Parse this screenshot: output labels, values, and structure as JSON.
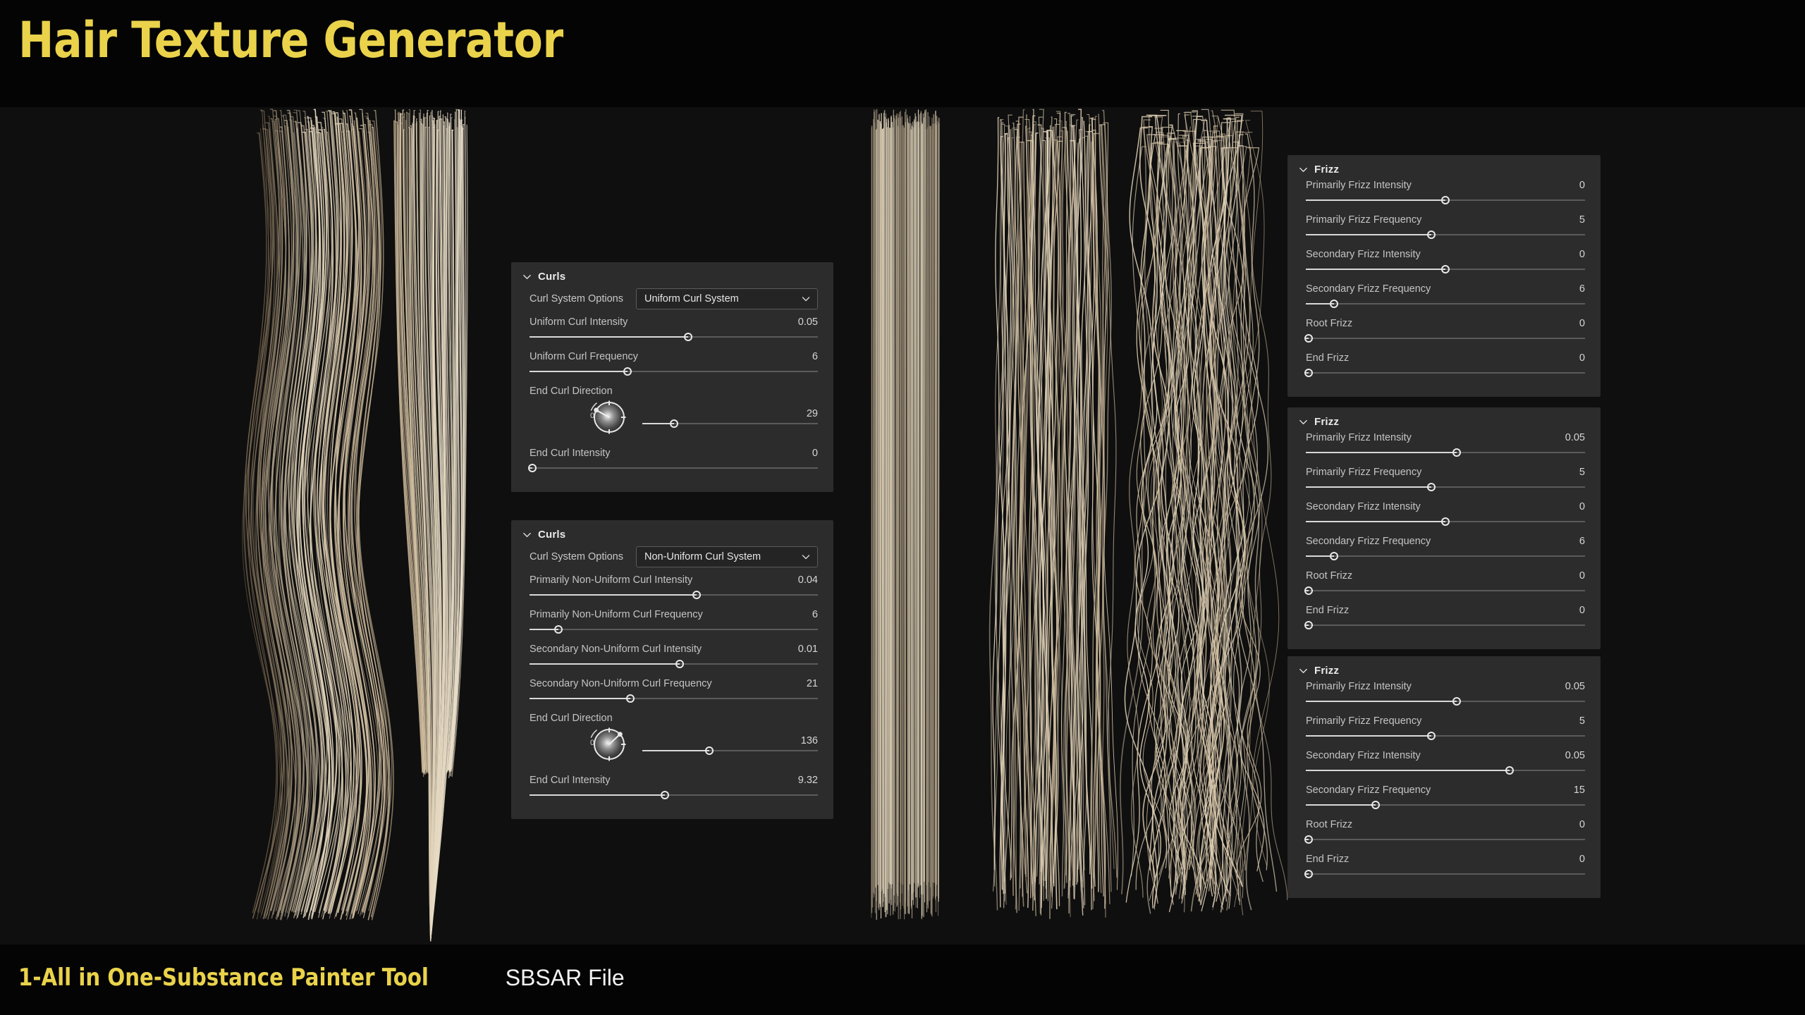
{
  "header": {
    "title": "Hair Texture Generator",
    "accent_color": "#ead34b",
    "band_color": "#040404"
  },
  "footer": {
    "main": "1-All in One-Substance Painter Tool",
    "sub": "SBSAR File"
  },
  "theme": {
    "background": "#0f0f0f",
    "panel_background": "#2c2c2c",
    "slider_fill": "#d9d9d9",
    "slider_track": "#5b5b5b",
    "hair_color": "#c9b596",
    "hair_highlight": "#e3d6bd",
    "hair_shadow": "#6f5f49"
  },
  "renders": [
    {
      "name": "wavy-uniform-curl-preview",
      "style": "wavy"
    },
    {
      "name": "tapered-curl-preview",
      "style": "tapered"
    },
    {
      "name": "straight-no-frizz-preview",
      "style": "straight"
    },
    {
      "name": "light-frizz-preview",
      "style": "light-frizz"
    },
    {
      "name": "heavy-frizz-preview",
      "style": "heavy-frizz"
    }
  ],
  "panels": {
    "curls": [
      {
        "title": "Curls",
        "dropdown": {
          "label": "Curl System Options",
          "value": "Uniform Curl System",
          "options": [
            "Uniform Curl System",
            "Non-Uniform Curl System"
          ]
        },
        "params": [
          {
            "label": "Uniform Curl Intensity",
            "value": "0.05",
            "pct": 55
          },
          {
            "label": "Uniform Curl Frequency",
            "value": "6",
            "pct": 34
          }
        ],
        "dial": {
          "label": "End Curl Direction",
          "value": "29",
          "angle": 299,
          "slider_pct": 18
        },
        "params_after": [
          {
            "label": "End Curl Intensity",
            "value": "0",
            "pct": 1
          }
        ]
      },
      {
        "title": "Curls",
        "dropdown": {
          "label": "Curl System Options",
          "value": "Non-Uniform Curl System",
          "options": [
            "Uniform Curl System",
            "Non-Uniform Curl System"
          ]
        },
        "params": [
          {
            "label": "Primarily Non-Uniform Curl Intensity",
            "value": "0.04",
            "pct": 58
          },
          {
            "label": "Primarily Non-Uniform Curl Frequency",
            "value": "6",
            "pct": 10
          },
          {
            "label": "Secondary Non-Uniform Curl Intensity",
            "value": "0.01",
            "pct": 52
          },
          {
            "label": "Secondary Non-Uniform Curl Frequency",
            "value": "21",
            "pct": 35
          }
        ],
        "dial": {
          "label": "End Curl Direction",
          "value": "136",
          "angle": 47,
          "slider_pct": 38
        },
        "params_after": [
          {
            "label": "End Curl Intensity",
            "value": "9.32",
            "pct": 47
          }
        ]
      }
    ],
    "frizz": [
      {
        "title": "Frizz",
        "params": [
          {
            "label": "Primarily Frizz Intensity",
            "value": "0",
            "pct": 50
          },
          {
            "label": "Primarily Frizz Frequency",
            "value": "5",
            "pct": 45
          },
          {
            "label": "Secondary Frizz Intensity",
            "value": "0",
            "pct": 50
          },
          {
            "label": "Secondary Frizz Frequency",
            "value": "6",
            "pct": 10
          },
          {
            "label": "Root Frizz",
            "value": "0",
            "pct": 1
          },
          {
            "label": "End Frizz",
            "value": "0",
            "pct": 1
          }
        ]
      },
      {
        "title": "Frizz",
        "params": [
          {
            "label": "Primarily Frizz Intensity",
            "value": "0.05",
            "pct": 54
          },
          {
            "label": "Primarily Frizz Frequency",
            "value": "5",
            "pct": 45
          },
          {
            "label": "Secondary Frizz Intensity",
            "value": "0",
            "pct": 50
          },
          {
            "label": "Secondary Frizz Frequency",
            "value": "6",
            "pct": 10
          },
          {
            "label": "Root Frizz",
            "value": "0",
            "pct": 1
          },
          {
            "label": "End Frizz",
            "value": "0",
            "pct": 1
          }
        ]
      },
      {
        "title": "Frizz",
        "params": [
          {
            "label": "Primarily Frizz Intensity",
            "value": "0.05",
            "pct": 54
          },
          {
            "label": "Primarily Frizz Frequency",
            "value": "5",
            "pct": 45
          },
          {
            "label": "Secondary Frizz Intensity",
            "value": "0.05",
            "pct": 73
          },
          {
            "label": "Secondary Frizz Frequency",
            "value": "15",
            "pct": 25
          },
          {
            "label": "Root Frizz",
            "value": "0",
            "pct": 1
          },
          {
            "label": "End Frizz",
            "value": "0",
            "pct": 1
          }
        ]
      }
    ]
  },
  "icons": {
    "collapse": "chevron-down-icon",
    "dropdown": "chevron-down-icon",
    "dial": "rotation-dial-icon"
  }
}
